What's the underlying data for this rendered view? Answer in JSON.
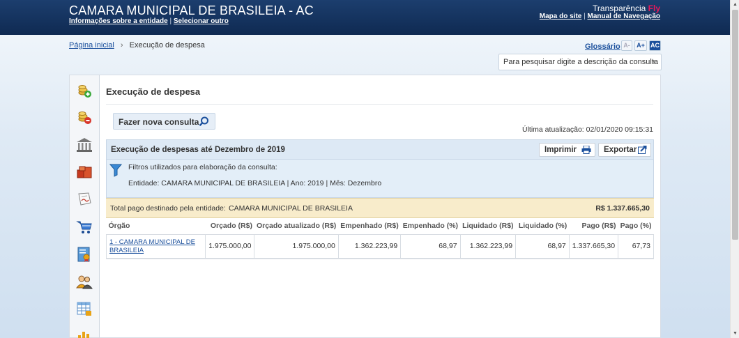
{
  "header": {
    "entity_title": "CAMARA MUNICIPAL DE BRASILEIA - AC",
    "info_link": "Informações sobre a entidade",
    "separator": "|",
    "select_other_link": "Selecionar outro",
    "brand_prefix": "Transparência",
    "brand_suffix": "Fly",
    "site_map_link": "Mapa do site",
    "manual_link": "Manual de Navegação"
  },
  "breadcrumb": {
    "home": "Página inicial",
    "arrow": "›",
    "current": "Execução de despesa"
  },
  "tools": {
    "glossary": "Glossário",
    "font_decrease": "A-",
    "font_increase": "A+",
    "contrast": "AC",
    "search_placeholder": "Para pesquisar digite a descrição da consulta"
  },
  "sidebar": {
    "icons": [
      "coins-add-icon",
      "coins-remove-icon",
      "bank-building-icon",
      "boxes-icon",
      "contract-document-icon",
      "shopping-cart-icon",
      "certificate-document-icon",
      "people-icon",
      "spreadsheet-icon",
      "bar-chart-icon"
    ]
  },
  "main": {
    "title": "Execução de despesa",
    "new_query_label": "Fazer nova consulta",
    "last_update_label": "Última atualização:",
    "last_update_value": "02/01/2020 09:15:31",
    "report_title": "Execução de despesas até Dezembro de 2019",
    "print_label": "Imprimir",
    "export_label": "Exportar",
    "filters_label": "Filtros utilizados para elaboração da consulta:",
    "filters_values": "Entidade: CAMARA MUNICIPAL DE BRASILEIA | Ano: 2019 | Mês: Dezembro",
    "total_label": "Total pago destinado pela entidade:",
    "total_entity": "CAMARA MUNICIPAL DE BRASILEIA",
    "total_value": "R$ 1.337.665,30"
  },
  "table": {
    "headers": [
      "Órgão",
      "Orçado (R$)",
      "Orçado atualizado (R$)",
      "Empenhado (R$)",
      "Empenhado (%)",
      "Liquidado (R$)",
      "Liquidado (%)",
      "Pago (R$)",
      "Pago (%)"
    ],
    "rows": [
      [
        "1 - CAMARA MUNICIPAL DE BRASILEIA",
        "1.975.000,00",
        "1.975.000,00",
        "1.362.223,99",
        "68,97",
        "1.362.223,99",
        "68,97",
        "1.337.665,30",
        "67,73"
      ]
    ]
  },
  "colors": {
    "header_bg": "#14355f",
    "accent_blue": "#1a4f9c",
    "fly_pink": "#e6195b",
    "total_row_bg": "#f8eccb"
  }
}
